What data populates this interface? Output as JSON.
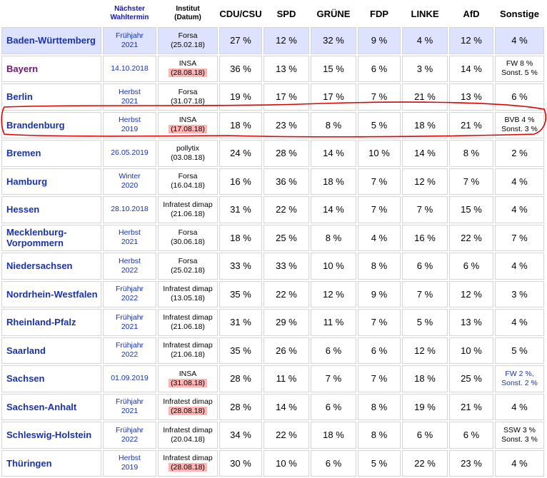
{
  "headers": {
    "land": "",
    "termin_line1": "Nächster",
    "termin_line2": "Wahltermin",
    "institut_line1": "Institut",
    "institut_line2": "(Datum)",
    "cdu": "CDU/CSU",
    "spd": "SPD",
    "gruene": "GRÜNE",
    "fdp": "FDP",
    "linke": "LINKE",
    "afd": "AfD",
    "sonstige": "Sonstige"
  },
  "rows": [
    {
      "land": "Baden-Württemberg",
      "termin": [
        "Frühjahr",
        "2021"
      ],
      "institut": "Forsa",
      "datum": "(25.02.18)",
      "datum_hl": false,
      "cdu": "27 %",
      "spd": "12 %",
      "gruene": "32 %",
      "fdp": "9 %",
      "linke": "4 %",
      "afd": "12 %",
      "sonstige": [
        "4 %"
      ],
      "highlight": true,
      "visited": false
    },
    {
      "land": "Bayern",
      "termin": [
        "14.10.2018"
      ],
      "institut": "INSA",
      "datum": "(28.08.18)",
      "datum_hl": true,
      "cdu": "36 %",
      "spd": "13 %",
      "gruene": "15 %",
      "fdp": "6 %",
      "linke": "3 %",
      "afd": "14 %",
      "sonstige": [
        "FW 8 %",
        "Sonst. 5 %"
      ],
      "highlight": false,
      "visited": true
    },
    {
      "land": "Berlin",
      "termin": [
        "Herbst",
        "2021"
      ],
      "institut": "Forsa",
      "datum": "(31.07.18)",
      "datum_hl": false,
      "cdu": "19 %",
      "spd": "17 %",
      "gruene": "17 %",
      "fdp": "7 %",
      "linke": "21 %",
      "afd": "13 %",
      "sonstige": [
        "6 %"
      ],
      "highlight": false,
      "visited": false
    },
    {
      "land": "Brandenburg",
      "termin": [
        "Herbst",
        "2019"
      ],
      "institut": "INSA",
      "datum": "(17.08.18)",
      "datum_hl": true,
      "cdu": "18 %",
      "spd": "23 %",
      "gruene": "8 %",
      "fdp": "5 %",
      "linke": "18 %",
      "afd": "21 %",
      "sonstige": [
        "BVB 4 %",
        "Sonst. 3 %"
      ],
      "highlight": false,
      "visited": false
    },
    {
      "land": "Bremen",
      "termin": [
        "26.05.2019"
      ],
      "institut": "pollytix",
      "datum": "(03.08.18)",
      "datum_hl": false,
      "cdu": "24 %",
      "spd": "28 %",
      "gruene": "14 %",
      "fdp": "10 %",
      "linke": "14 %",
      "afd": "8 %",
      "sonstige": [
        "2 %"
      ],
      "highlight": false,
      "visited": false
    },
    {
      "land": "Hamburg",
      "termin": [
        "Winter",
        "2020"
      ],
      "institut": "Forsa",
      "datum": "(16.04.18)",
      "datum_hl": false,
      "cdu": "16 %",
      "spd": "36 %",
      "gruene": "18 %",
      "fdp": "7 %",
      "linke": "12 %",
      "afd": "7 %",
      "sonstige": [
        "4 %"
      ],
      "highlight": false,
      "visited": false
    },
    {
      "land": "Hessen",
      "termin": [
        "28.10.2018"
      ],
      "institut": "Infratest dimap",
      "datum": "(21.06.18)",
      "datum_hl": false,
      "cdu": "31 %",
      "spd": "22 %",
      "gruene": "14 %",
      "fdp": "7 %",
      "linke": "7 %",
      "afd": "15 %",
      "sonstige": [
        "4 %"
      ],
      "highlight": false,
      "visited": false
    },
    {
      "land": "Mecklenburg-Vorpommern",
      "termin": [
        "Herbst",
        "2021"
      ],
      "institut": "Forsa",
      "datum": "(30.06.18)",
      "datum_hl": false,
      "cdu": "18 %",
      "spd": "25 %",
      "gruene": "8 %",
      "fdp": "4 %",
      "linke": "16 %",
      "afd": "22 %",
      "sonstige": [
        "7 %"
      ],
      "highlight": false,
      "visited": false
    },
    {
      "land": "Niedersachsen",
      "termin": [
        "Herbst",
        "2022"
      ],
      "institut": "Forsa",
      "datum": "(25.02.18)",
      "datum_hl": false,
      "cdu": "33 %",
      "spd": "33 %",
      "gruene": "10 %",
      "fdp": "8 %",
      "linke": "6 %",
      "afd": "6 %",
      "sonstige": [
        "4 %"
      ],
      "highlight": false,
      "visited": false
    },
    {
      "land": "Nordrhein-Westfalen",
      "termin": [
        "Frühjahr",
        "2022"
      ],
      "institut": "Infratest dimap",
      "datum": "(13.05.18)",
      "datum_hl": false,
      "cdu": "35 %",
      "spd": "22 %",
      "gruene": "12 %",
      "fdp": "9 %",
      "linke": "7 %",
      "afd": "12 %",
      "sonstige": [
        "3 %"
      ],
      "highlight": false,
      "visited": false
    },
    {
      "land": "Rheinland-Pfalz",
      "termin": [
        "Frühjahr",
        "2021"
      ],
      "institut": "Infratest dimap",
      "datum": "(21.06.18)",
      "datum_hl": false,
      "cdu": "31 %",
      "spd": "29 %",
      "gruene": "11 %",
      "fdp": "7 %",
      "linke": "5 %",
      "afd": "13 %",
      "sonstige": [
        "4 %"
      ],
      "highlight": false,
      "visited": false
    },
    {
      "land": "Saarland",
      "termin": [
        "Frühjahr",
        "2022"
      ],
      "institut": "Infratest dimap",
      "datum": "(21.06.18)",
      "datum_hl": false,
      "cdu": "35 %",
      "spd": "26 %",
      "gruene": "6 %",
      "fdp": "6 %",
      "linke": "12 %",
      "afd": "10 %",
      "sonstige": [
        "5 %"
      ],
      "highlight": false,
      "visited": false
    },
    {
      "land": "Sachsen",
      "termin": [
        "01.09.2019"
      ],
      "institut": "INSA",
      "datum": "(31.08.18)",
      "datum_hl": true,
      "cdu": "28 %",
      "spd": "11 %",
      "gruene": "7 %",
      "fdp": "7 %",
      "linke": "18 %",
      "afd": "25 %",
      "sonstige": [
        "FW 2 %,",
        "Sonst. 2 %"
      ],
      "sonstige_link": true,
      "highlight": false,
      "visited": false
    },
    {
      "land": "Sachsen-Anhalt",
      "termin": [
        "Frühjahr",
        "2021"
      ],
      "institut": "Infratest dimap",
      "datum": "(28.08.18)",
      "datum_hl": true,
      "cdu": "28 %",
      "spd": "14 %",
      "gruene": "6 %",
      "fdp": "8 %",
      "linke": "19 %",
      "afd": "21 %",
      "sonstige": [
        "4 %"
      ],
      "highlight": false,
      "visited": false
    },
    {
      "land": "Schleswig-Holstein",
      "termin": [
        "Frühjahr",
        "2022"
      ],
      "institut": "Infratest dimap",
      "datum": "(20.04.18)",
      "datum_hl": false,
      "cdu": "34 %",
      "spd": "22 %",
      "gruene": "18 %",
      "fdp": "8 %",
      "linke": "6 %",
      "afd": "6 %",
      "sonstige": [
        "SSW 3 %",
        "Sonst. 3 %"
      ],
      "highlight": false,
      "visited": false
    },
    {
      "land": "Thüringen",
      "termin": [
        "Herbst",
        "2019"
      ],
      "institut": "Infratest dimap",
      "datum": "(28.08.18)",
      "datum_hl": true,
      "cdu": "30 %",
      "spd": "10 %",
      "gruene": "6 %",
      "fdp": "5 %",
      "linke": "22 %",
      "afd": "23 %",
      "sonstige": [
        "4 %"
      ],
      "highlight": false,
      "visited": false
    }
  ],
  "annotation": {
    "color": "#e00000",
    "target_row": "Brandenburg"
  }
}
